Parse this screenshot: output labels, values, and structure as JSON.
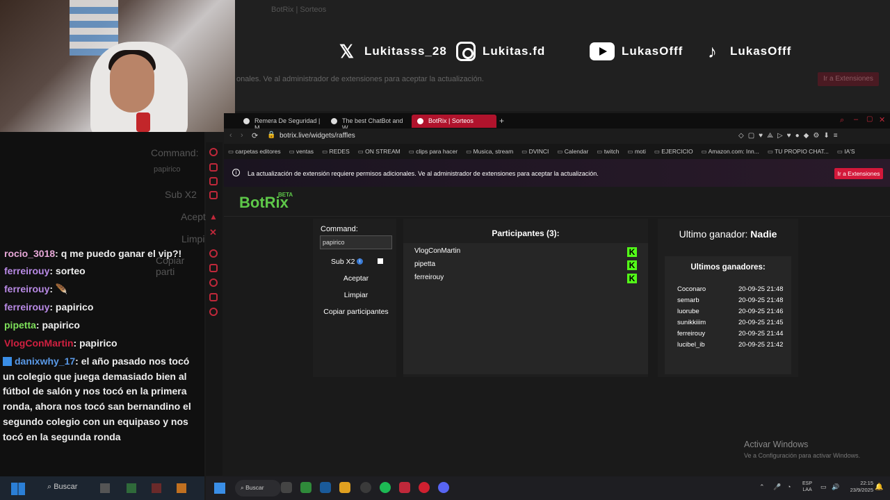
{
  "background_browser": {
    "tab_title": "BotRix | Sorteos",
    "notice_text": "onales. Ve al administrador de extensiones para aceptar la actualización.",
    "extension_button": "Ir a Extensiones"
  },
  "socials": [
    {
      "icon": "x-icon",
      "handle": "Lukitasss_28"
    },
    {
      "icon": "instagram-icon",
      "handle": "Lukitas.fd"
    },
    {
      "icon": "youtube-icon",
      "handle": "LukasOfff"
    },
    {
      "icon": "tiktok-icon",
      "handle": "LukasOfff"
    }
  ],
  "chat": {
    "ghost": {
      "command": "Command:",
      "value": "papirico",
      "sub": "Sub X2",
      "accept": "Acept",
      "clean": "Limpi",
      "copy": "Copiar parti"
    },
    "messages": [
      {
        "user": "rocio_3018",
        "color": "#e8a8d8",
        "text": ": q me puedo ganar el vip?!"
      },
      {
        "user": "ferreirouy",
        "color": "#b98ae6",
        "text": ": sorteo"
      },
      {
        "user": "ferreirouy",
        "color": "#b98ae6",
        "text": ": 🪶"
      },
      {
        "user": "ferreirouy",
        "color": "#b98ae6",
        "text": ": papirico"
      },
      {
        "user": "pipetta",
        "color": "#7ee05a",
        "text": ": papirico"
      },
      {
        "user": "VlogConMartin",
        "color": "#d02040",
        "text": ": papirico"
      }
    ],
    "long_message": {
      "user": "danixwhy_17",
      "color": "#5a9ae8",
      "text": ": el año pasado nos tocó un colegio que juega demasiado bien al fútbol de salón y nos tocó en la primera ronda, ahora nos tocó san bernandino el segundo colegio con un equipaso y nos tocó en la segunda ronda"
    }
  },
  "browser": {
    "tabs": [
      "Remera De Seguridad | M",
      "The best ChatBot and W",
      "BotRix | Sorteos"
    ],
    "url": "botrix.live/widgets/raffles",
    "bookmarks": [
      "carpetas editores",
      "ventas",
      "REDES",
      "ON STREAM",
      "clips para hacer",
      "Musica, stream",
      "DVINCI",
      "Calendar",
      "twitch",
      "moti",
      "EJERCICIO",
      "Amazon.com: Inn...",
      "TU PROPIO CHAT...",
      "IA'S"
    ],
    "notice": "La actualización de extensión requiere permisos adicionales. Ve al administrador de extensiones para aceptar la actualización.",
    "notice_button": "Ir a Extensiones"
  },
  "botrix": {
    "logo": "BotRix",
    "logo_badge": "BETA",
    "command_label": "Command:",
    "command_value": "papirico",
    "sub_label": "Sub X2",
    "accept": "Aceptar",
    "clear": "Limpiar",
    "copy": "Copiar participantes",
    "participants_title": "Participantes (3):",
    "participants": [
      "VlogConMartin",
      "pipetta",
      "ferreirouy"
    ],
    "winner_title_prefix": "Ultimo ganador:",
    "winner_name": "Nadie",
    "winners_title": "Ultimos ganadores:",
    "winners": [
      {
        "name": "Coconaro",
        "date": "20-09-25 21:48"
      },
      {
        "name": "semarb",
        "date": "20-09-25 21:48"
      },
      {
        "name": "luorube",
        "date": "20-09-25 21:46"
      },
      {
        "name": "sunikkiiim",
        "date": "20-09-25 21:45"
      },
      {
        "name": "ferreirouy",
        "date": "20-09-25 21:44"
      },
      {
        "name": "lucibel_ib",
        "date": "20-09-25 21:42"
      }
    ]
  },
  "watermark": {
    "line1": "Activar Windows",
    "line2": "Ve a Configuración para activar Windows."
  },
  "taskbar": {
    "search": "Buscar",
    "search_left": "Buscar",
    "lang": "ESP",
    "region": "LAA",
    "time": "22:15",
    "date": "23/9/2025"
  }
}
